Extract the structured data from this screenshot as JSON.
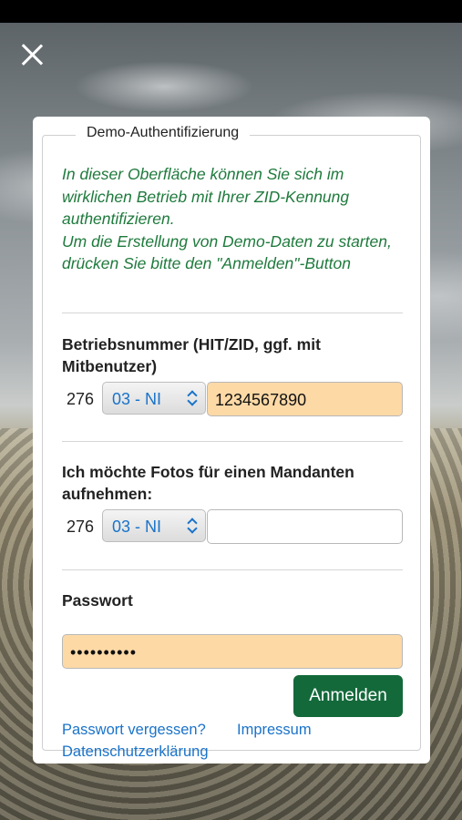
{
  "dialog": {
    "legend": "Demo-Authentifizierung",
    "intro_line1": "In dieser Oberfläche können Sie sich im wirklichen Betrieb mit Ihrer ZID-Kennung authentifizieren.",
    "intro_line2": "Um die Erstellung von Demo-Daten zu starten, drücken Sie bitte den \"Anmelden\"-Button"
  },
  "betrieb": {
    "label": "Betriebsnummer (HIT/ZID, ggf. mit Mitbenutzer)",
    "prefix": "276",
    "region": "03 - NI",
    "value": "1234567890"
  },
  "mandant": {
    "label": "Ich möchte Fotos für einen Mandanten aufnehmen:",
    "prefix": "276",
    "region": "03 - NI",
    "value": ""
  },
  "password": {
    "label": "Passwort",
    "masked": "••••••••••"
  },
  "actions": {
    "login": "Anmelden"
  },
  "links": {
    "forgot": "Passwort vergessen?",
    "imprint": "Impressum",
    "privacy": "Datenschutzerklärung"
  },
  "icons": {
    "close": "close-icon",
    "select_chevron": "chevron-up-down-icon"
  },
  "colors": {
    "accent_green": "#13693a",
    "intro_text": "#1f7a3d",
    "field_highlight": "#fdd9a6",
    "link": "#1a73c9"
  }
}
